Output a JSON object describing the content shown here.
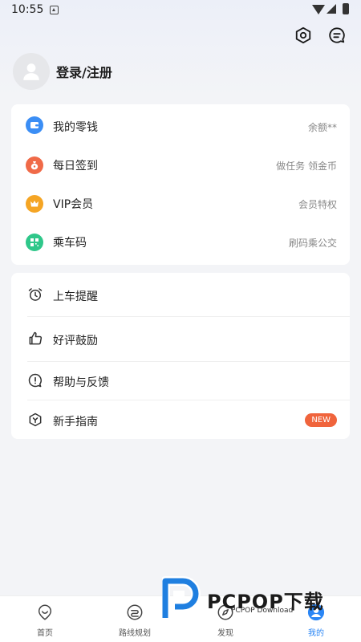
{
  "status_bar": {
    "time": "10:55"
  },
  "header": {
    "settings_icon": "hexagon-settings-icon",
    "message_icon": "chat-message-icon"
  },
  "profile": {
    "login_label": "登录/注册",
    "avatar_icon": "user-avatar-icon"
  },
  "wallet_section": {
    "items": [
      {
        "label": "我的零钱",
        "right": "余额**",
        "icon": "wallet-icon",
        "color": "#3b8ef5"
      },
      {
        "label": "每日签到",
        "right": "做任务 领金币",
        "icon": "money-bag-icon",
        "color": "#f06a48"
      },
      {
        "label": "VIP会员",
        "right": "会员特权",
        "icon": "crown-icon",
        "color": "#f5a524"
      },
      {
        "label": "乘车码",
        "right": "刷码乘公交",
        "icon": "qr-code-icon",
        "color": "#2fc78a"
      }
    ]
  },
  "services_section": {
    "items": [
      {
        "label": "上车提醒",
        "icon": "alarm-clock-icon"
      },
      {
        "label": "好评鼓励",
        "icon": "thumbs-up-icon"
      },
      {
        "label": "帮助与反馈",
        "icon": "exclamation-circle-icon"
      },
      {
        "label": "新手指南",
        "icon": "guide-hexagon-icon",
        "badge": "NEW"
      }
    ]
  },
  "bottom_nav": {
    "items": [
      {
        "label": "首页",
        "icon": "home-map-pin-icon"
      },
      {
        "label": "路线规划",
        "icon": "route-icon"
      },
      {
        "label": "发现",
        "icon": "compass-icon"
      },
      {
        "label": "我的",
        "icon": "profile-icon",
        "active": true
      }
    ]
  },
  "watermark": {
    "brand": "PCPOP下载",
    "sub": "PCPOP Download"
  },
  "colors": {
    "accent": "#2a86f5",
    "badge": "#f0643c"
  }
}
